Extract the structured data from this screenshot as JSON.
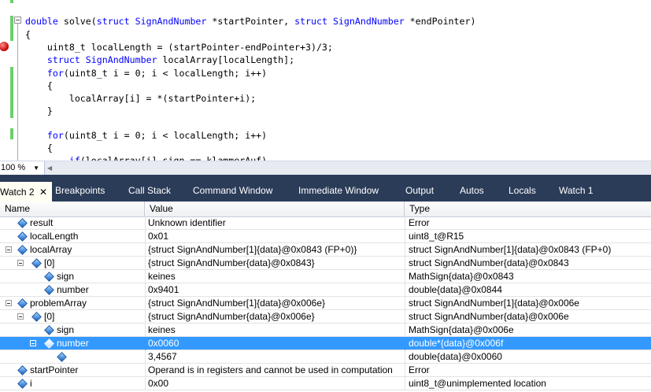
{
  "editor": {
    "lines": [
      [
        {
          "t": "double",
          "k": 1
        },
        {
          "t": " solve("
        },
        {
          "t": "struct",
          "k": 1
        },
        {
          "t": " "
        },
        {
          "t": "SignAndNumber",
          "k": 1
        },
        {
          "t": " *startPointer, "
        },
        {
          "t": "struct",
          "k": 1
        },
        {
          "t": " "
        },
        {
          "t": "SignAndNumber",
          "k": 1
        },
        {
          "t": " *endPointer)"
        }
      ],
      [
        {
          "t": "{"
        }
      ],
      [
        {
          "t": "    uint8_t localLength = (startPointer-endPointer+3)/3;"
        }
      ],
      [
        {
          "t": "    "
        },
        {
          "t": "struct",
          "k": 1
        },
        {
          "t": " "
        },
        {
          "t": "SignAndNumber",
          "k": 1
        },
        {
          "t": " localArray[localLength];"
        }
      ],
      [
        {
          "t": "    "
        },
        {
          "t": "for",
          "k": 1
        },
        {
          "t": "(uint8_t i = 0; i < localLength; i++)"
        }
      ],
      [
        {
          "t": "    {"
        }
      ],
      [
        {
          "t": "        localArray[i] = *(startPointer+i);"
        }
      ],
      [
        {
          "t": "    }"
        }
      ],
      [
        {
          "t": ""
        }
      ],
      [
        {
          "t": "    "
        },
        {
          "t": "for",
          "k": 1
        },
        {
          "t": "(uint8_t i = 0; i < localLength; i++)"
        }
      ],
      [
        {
          "t": "    {"
        }
      ],
      [
        {
          "t": "        "
        },
        {
          "t": "if",
          "k": 1
        },
        {
          "t": "(localArray[i].sign == klammerAuf)"
        }
      ]
    ],
    "zoom": "100 %"
  },
  "tabs": [
    "Watch 2",
    "Breakpoints",
    "Call Stack",
    "Command Window",
    "Immediate Window",
    "Output",
    "Autos",
    "Locals",
    "Watch 1"
  ],
  "tab_close": "✕",
  "watch": {
    "columns": [
      "Name",
      "Value",
      "Type"
    ],
    "rows": [
      {
        "name": "result",
        "value": "Unknown identifier",
        "type": "Error",
        "level": 0,
        "expander": false,
        "selected": false
      },
      {
        "name": "localLength",
        "value": "0x01",
        "type": "uint8_t@R15",
        "level": 0,
        "expander": false,
        "selected": false
      },
      {
        "name": "localArray",
        "value": "{struct SignAndNumber[1]{data}@0x0843 (FP+0)}",
        "type": "struct SignAndNumber[1]{data}@0x0843 (FP+0)",
        "level": 0,
        "expander": true,
        "selected": false
      },
      {
        "name": "[0]",
        "value": "{struct SignAndNumber{data}@0x0843}",
        "type": "struct SignAndNumber{data}@0x0843",
        "level": 1,
        "expander": true,
        "selected": false
      },
      {
        "name": "sign",
        "value": "keines",
        "type": "MathSign{data}@0x0843",
        "level": 2,
        "expander": false,
        "selected": false
      },
      {
        "name": "number",
        "value": "0x9401",
        "type": "double{data}@0x0844",
        "level": 2,
        "expander": false,
        "selected": false
      },
      {
        "name": "problemArray",
        "value": "{struct SignAndNumber[1]{data}@0x006e}",
        "type": "struct SignAndNumber[1]{data}@0x006e",
        "level": 0,
        "expander": true,
        "selected": false
      },
      {
        "name": "[0]",
        "value": "{struct SignAndNumber{data}@0x006e}",
        "type": "struct SignAndNumber{data}@0x006e",
        "level": 1,
        "expander": true,
        "selected": false
      },
      {
        "name": "sign",
        "value": "keines",
        "type": "MathSign{data}@0x006e",
        "level": 2,
        "expander": false,
        "selected": false
      },
      {
        "name": "number",
        "value": "0x0060",
        "type": "double*{data}@0x006f",
        "level": 2,
        "expander": true,
        "selected": true
      },
      {
        "name": "",
        "value": "3,4567",
        "type": "double{data}@0x0060",
        "level": 3,
        "expander": false,
        "selected": false
      },
      {
        "name": "startPointer",
        "value": "Operand is in registers and cannot be used in computation",
        "type": "Error",
        "level": 0,
        "expander": false,
        "selected": false
      },
      {
        "name": "i",
        "value": "0x00",
        "type": "uint8_t@unimplemented location",
        "level": 0,
        "expander": false,
        "selected": false
      }
    ]
  },
  "colors": {
    "tab_strip": "#2b3c59",
    "selection": "#3399ff",
    "keyword": "#0000ff",
    "breakpoint": "#c40000"
  }
}
